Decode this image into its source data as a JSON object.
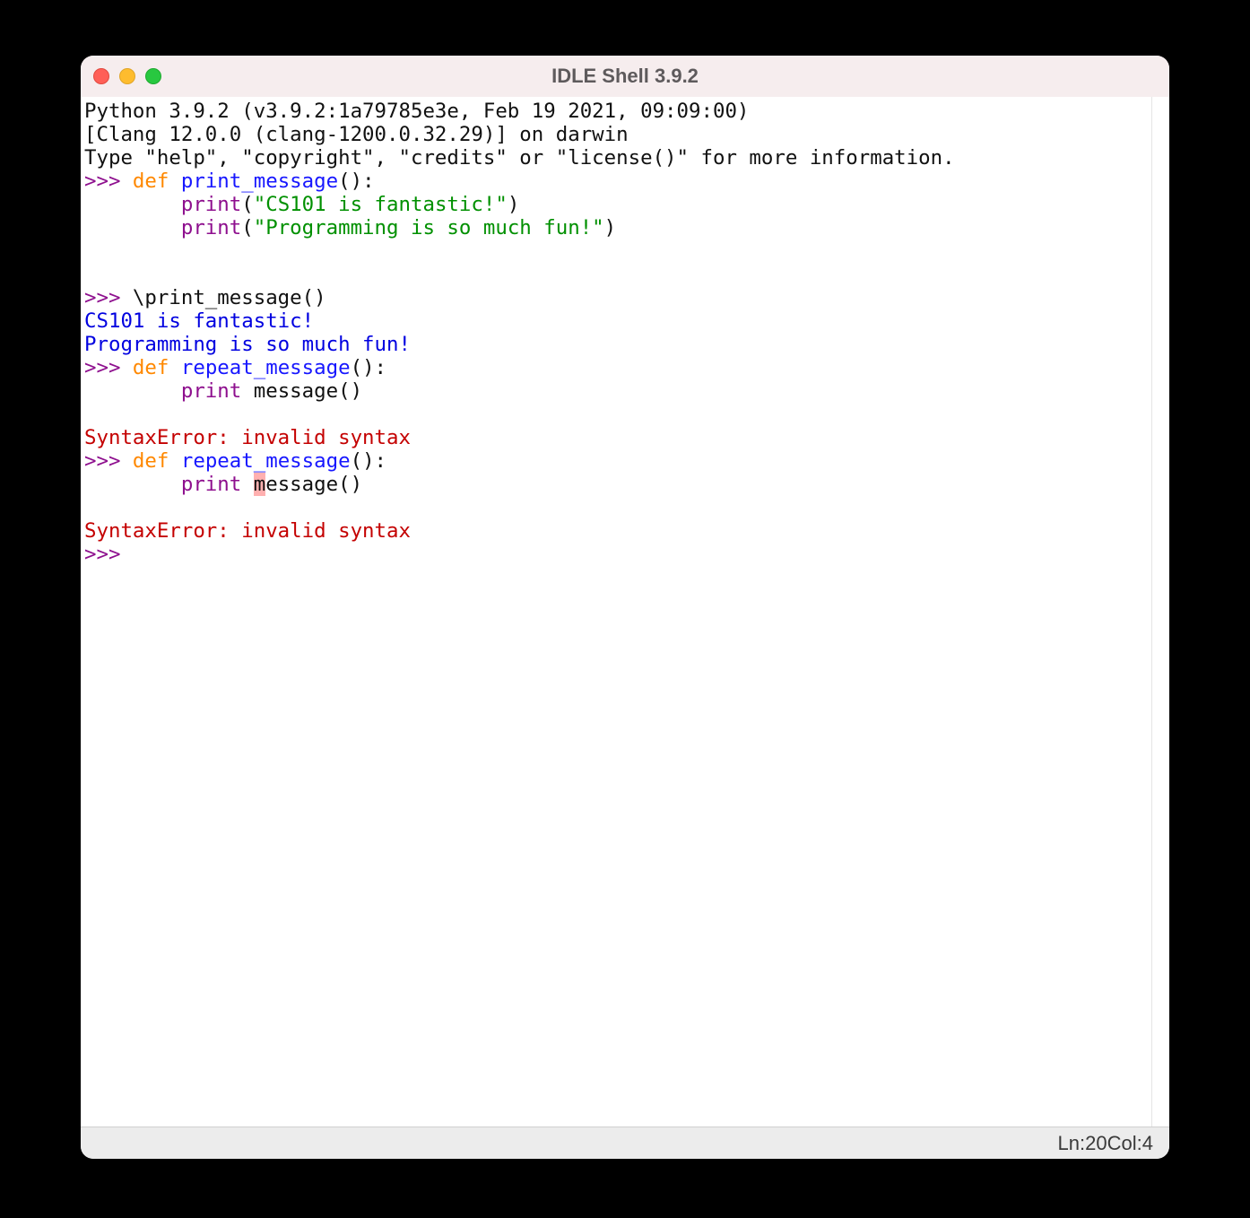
{
  "window": {
    "title": "IDLE Shell 3.9.2"
  },
  "colors": {
    "prompt": "#8e0f8e",
    "keyword": "#ff8800",
    "funcname": "#1717ff",
    "builtin": "#8e0f8e",
    "string": "#009000",
    "stdout": "#1717ff",
    "error": "#c40000"
  },
  "prompt": ">>> ",
  "banner": [
    "Python 3.9.2 (v3.9.2:1a79785e3e, Feb 19 2021, 09:09:00) ",
    "[Clang 12.0.0 (clang-1200.0.32.29)] on darwin",
    "Type \"help\", \"copyright\", \"credits\" or \"license()\" for more information."
  ],
  "lines": {
    "def1": {
      "kw": "def",
      "name": "print_message",
      "parens": "():",
      "body1_builtin": "print",
      "body1_open": "(",
      "body1_str": "\"CS101 is fantastic!\"",
      "body1_close": ")",
      "body2_builtin": "print",
      "body2_open": "(",
      "body2_str": "\"Programming is so much fun!\"",
      "body2_close": ")"
    },
    "call1": "\\print_message()",
    "out1": "CS101 is fantastic!",
    "out2": "Programming is so much fun!",
    "def2": {
      "kw": "def",
      "name": "repeat_message",
      "parens": "():",
      "body_builtin": "print",
      "body_rest": " message()"
    },
    "blank_indent": "\t",
    "err1": "SyntaxError: invalid syntax",
    "def3": {
      "kw": "def",
      "name": "repeat_message",
      "parens": "():",
      "body_builtin": "print",
      "body_sp": " ",
      "body_hl": "m",
      "body_rest": "essage()"
    },
    "err2": "SyntaxError: invalid syntax",
    "cursor": " "
  },
  "indent": "        ",
  "status": {
    "ln_label": "Ln: ",
    "ln": "20",
    "col_label": "  Col: ",
    "col": "4"
  }
}
